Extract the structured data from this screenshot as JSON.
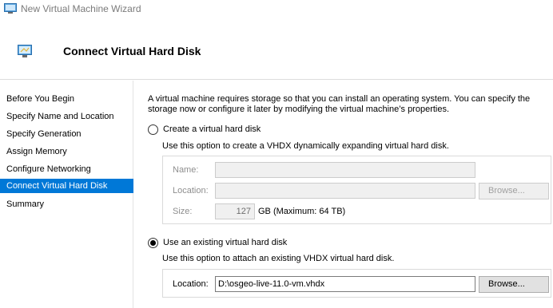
{
  "window": {
    "title": "New Virtual Machine Wizard"
  },
  "header": {
    "title": "Connect Virtual Hard Disk"
  },
  "sidebar": {
    "items": [
      {
        "label": "Before You Begin"
      },
      {
        "label": "Specify Name and Location"
      },
      {
        "label": "Specify Generation"
      },
      {
        "label": "Assign Memory"
      },
      {
        "label": "Configure Networking"
      },
      {
        "label": "Connect Virtual Hard Disk",
        "selected": true
      },
      {
        "label": "Summary"
      }
    ]
  },
  "main": {
    "description": "A virtual machine requires storage so that you can install an operating system. You can specify the storage now or configure it later by modifying the virtual machine’s properties.",
    "create_option": {
      "label": "Create a virtual hard disk",
      "checked": false,
      "hint": "Use this option to create a VHDX dynamically expanding virtual hard disk.",
      "name_label": "Name:",
      "name_value": "",
      "location_label": "Location:",
      "location_value": "",
      "browse_label": "Browse...",
      "size_label": "Size:",
      "size_value": "127",
      "size_suffix": "GB (Maximum: 64 TB)"
    },
    "existing_option": {
      "label": "Use an existing virtual hard disk",
      "checked": true,
      "hint": "Use this option to attach an existing VHDX virtual hard disk.",
      "location_label": "Location:",
      "location_value": "D:\\osgeo-live-11.0-vm.vhdx",
      "browse_label": "Browse..."
    }
  },
  "colors": {
    "selection": "#0078d7",
    "disabled_text": "#8e8e8e"
  }
}
